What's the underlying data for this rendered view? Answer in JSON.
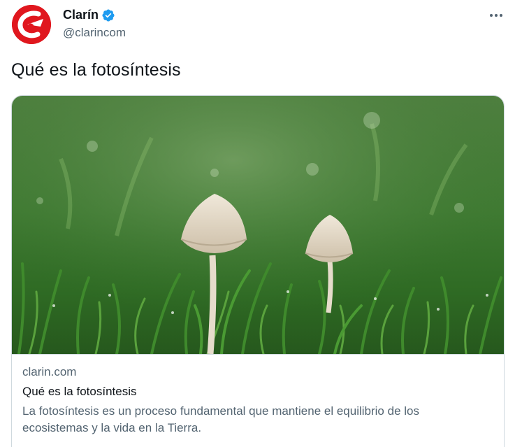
{
  "author": {
    "display_name": "Clarín",
    "handle": "@clarincom",
    "verified": true,
    "avatar_icon": "clarin-logo-icon",
    "brand_color": "#e0171e"
  },
  "menu": {
    "icon": "more-horizontal-icon"
  },
  "tweet": {
    "text": "Qué es la fotosíntesis"
  },
  "card": {
    "image_description_icon": "mushrooms-in-grass-photo",
    "domain": "clarin.com",
    "title": "Qué es la fotosíntesis",
    "description": "La fotosíntesis es un proceso fundamental que mantiene el equilibrio de los ecosistemas y la vida en la Tierra."
  },
  "colors": {
    "verified_blue": "#1d9bf0",
    "secondary_text": "#536471",
    "border": "#cfd9de"
  }
}
